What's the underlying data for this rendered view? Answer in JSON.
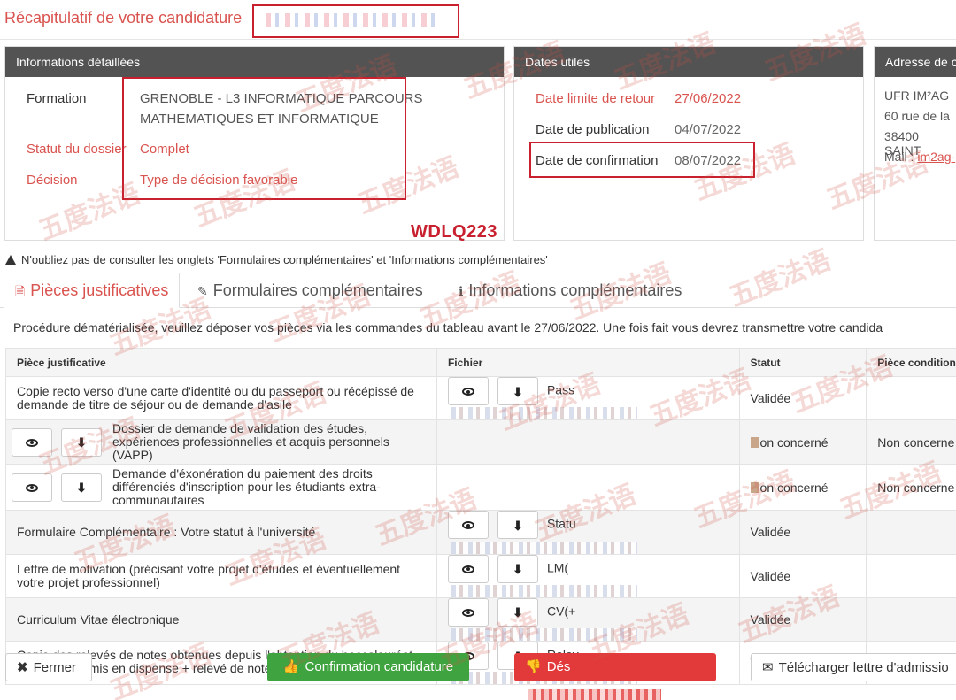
{
  "header": {
    "title": "Récapitulatif de votre candidature"
  },
  "details_panel": {
    "heading": "Informations détaillées",
    "formation_label": "Formation",
    "formation_value_line1": "GRENOBLE - L3 INFORMATIQUE PARCOURS",
    "formation_value_line2": "MATHEMATIQUES ET INFORMATIQUE",
    "statut_label": "Statut du dossier",
    "statut_value": "Complet",
    "decision_label": "Décision",
    "decision_value": "Type de décision favorable"
  },
  "dates_panel": {
    "heading": "Dates utiles",
    "retour_label": "Date limite de retour",
    "retour_value": "27/06/2022",
    "publication_label": "Date de publication",
    "publication_value": "04/07/2022",
    "confirmation_label": "Date de confirmation",
    "confirmation_value": "08/07/2022"
  },
  "address_panel": {
    "heading": "Adresse de c",
    "line1": "UFR IM²AG",
    "line2": "60 rue de la",
    "line3": "38400 SAINT",
    "mail_label": "Mail :",
    "mail_value": "im2ag-"
  },
  "annotation_code": "WDLQ223",
  "warning": "N'oubliez pas de consulter les onglets 'Formulaires complémentaires' et 'Informations complémentaires'",
  "tabs": [
    {
      "label": "Pièces justificatives"
    },
    {
      "label": "Formulaires complémentaires"
    },
    {
      "label": "Informations complémentaires"
    }
  ],
  "procedure_text": "Procédure dématérialisée, veuillez déposer vos pièces via les commandes du tableau avant le 27/06/2022. Une fois fait vous devrez transmettre votre candida",
  "table": {
    "headers": [
      "Pièce justificative",
      "Fichier",
      "Statut",
      "Pièce condition"
    ],
    "rows": [
      {
        "piece": "Copie recto verso d'une carte d'identité ou du passeport ou récépissé de demande de titre de séjour ou de demande d'asile",
        "file": "Pass",
        "statut": "Validée",
        "condition": ""
      },
      {
        "piece": "Dossier de demande de validation des études, expériences professionnelles et acquis personnels (VAPP)",
        "file": "",
        "statut": "on concerné",
        "condition": "Non concerne"
      },
      {
        "piece": "Demande d'éxonération du paiement des droits différenciés d'inscription pour les étudiants extra-communautaires",
        "file": "",
        "statut": "on concerné",
        "condition": "Non concerne"
      },
      {
        "piece": "Formulaire Complémentaire : Votre statut à l'université",
        "file": "Statu",
        "statut": "Validée",
        "condition": ""
      },
      {
        "piece": "Lettre de motivation (précisant votre projet d'études et éventuellement votre projet professionnel)",
        "file": "LM(",
        "statut": "Validée",
        "condition": ""
      },
      {
        "piece": "Curriculum Vitae électronique",
        "file": "CV(+",
        "statut": "Validée",
        "condition": ""
      },
      {
        "piece": "Copie des relevés de notes obtenues depuis l'obtention du baccalauréat ou du titre admis en dispense + relevé de notes provisoire pour l'année en cours",
        "file": "Relev",
        "statut": "Validée",
        "condition": ""
      }
    ]
  },
  "footer": {
    "fermer": "Fermer",
    "confirmation": "Confirmation candidature",
    "desistement": "Dés",
    "lettre": "Télécharger lettre d'admissio"
  },
  "watermark_text": "五度法语",
  "colors": {
    "accent_red": "#d9534f",
    "panel_header": "#535353",
    "confirm_green": "#3fa43f",
    "desist_red": "#e23a3a",
    "highlight_box": "#c8202f"
  }
}
